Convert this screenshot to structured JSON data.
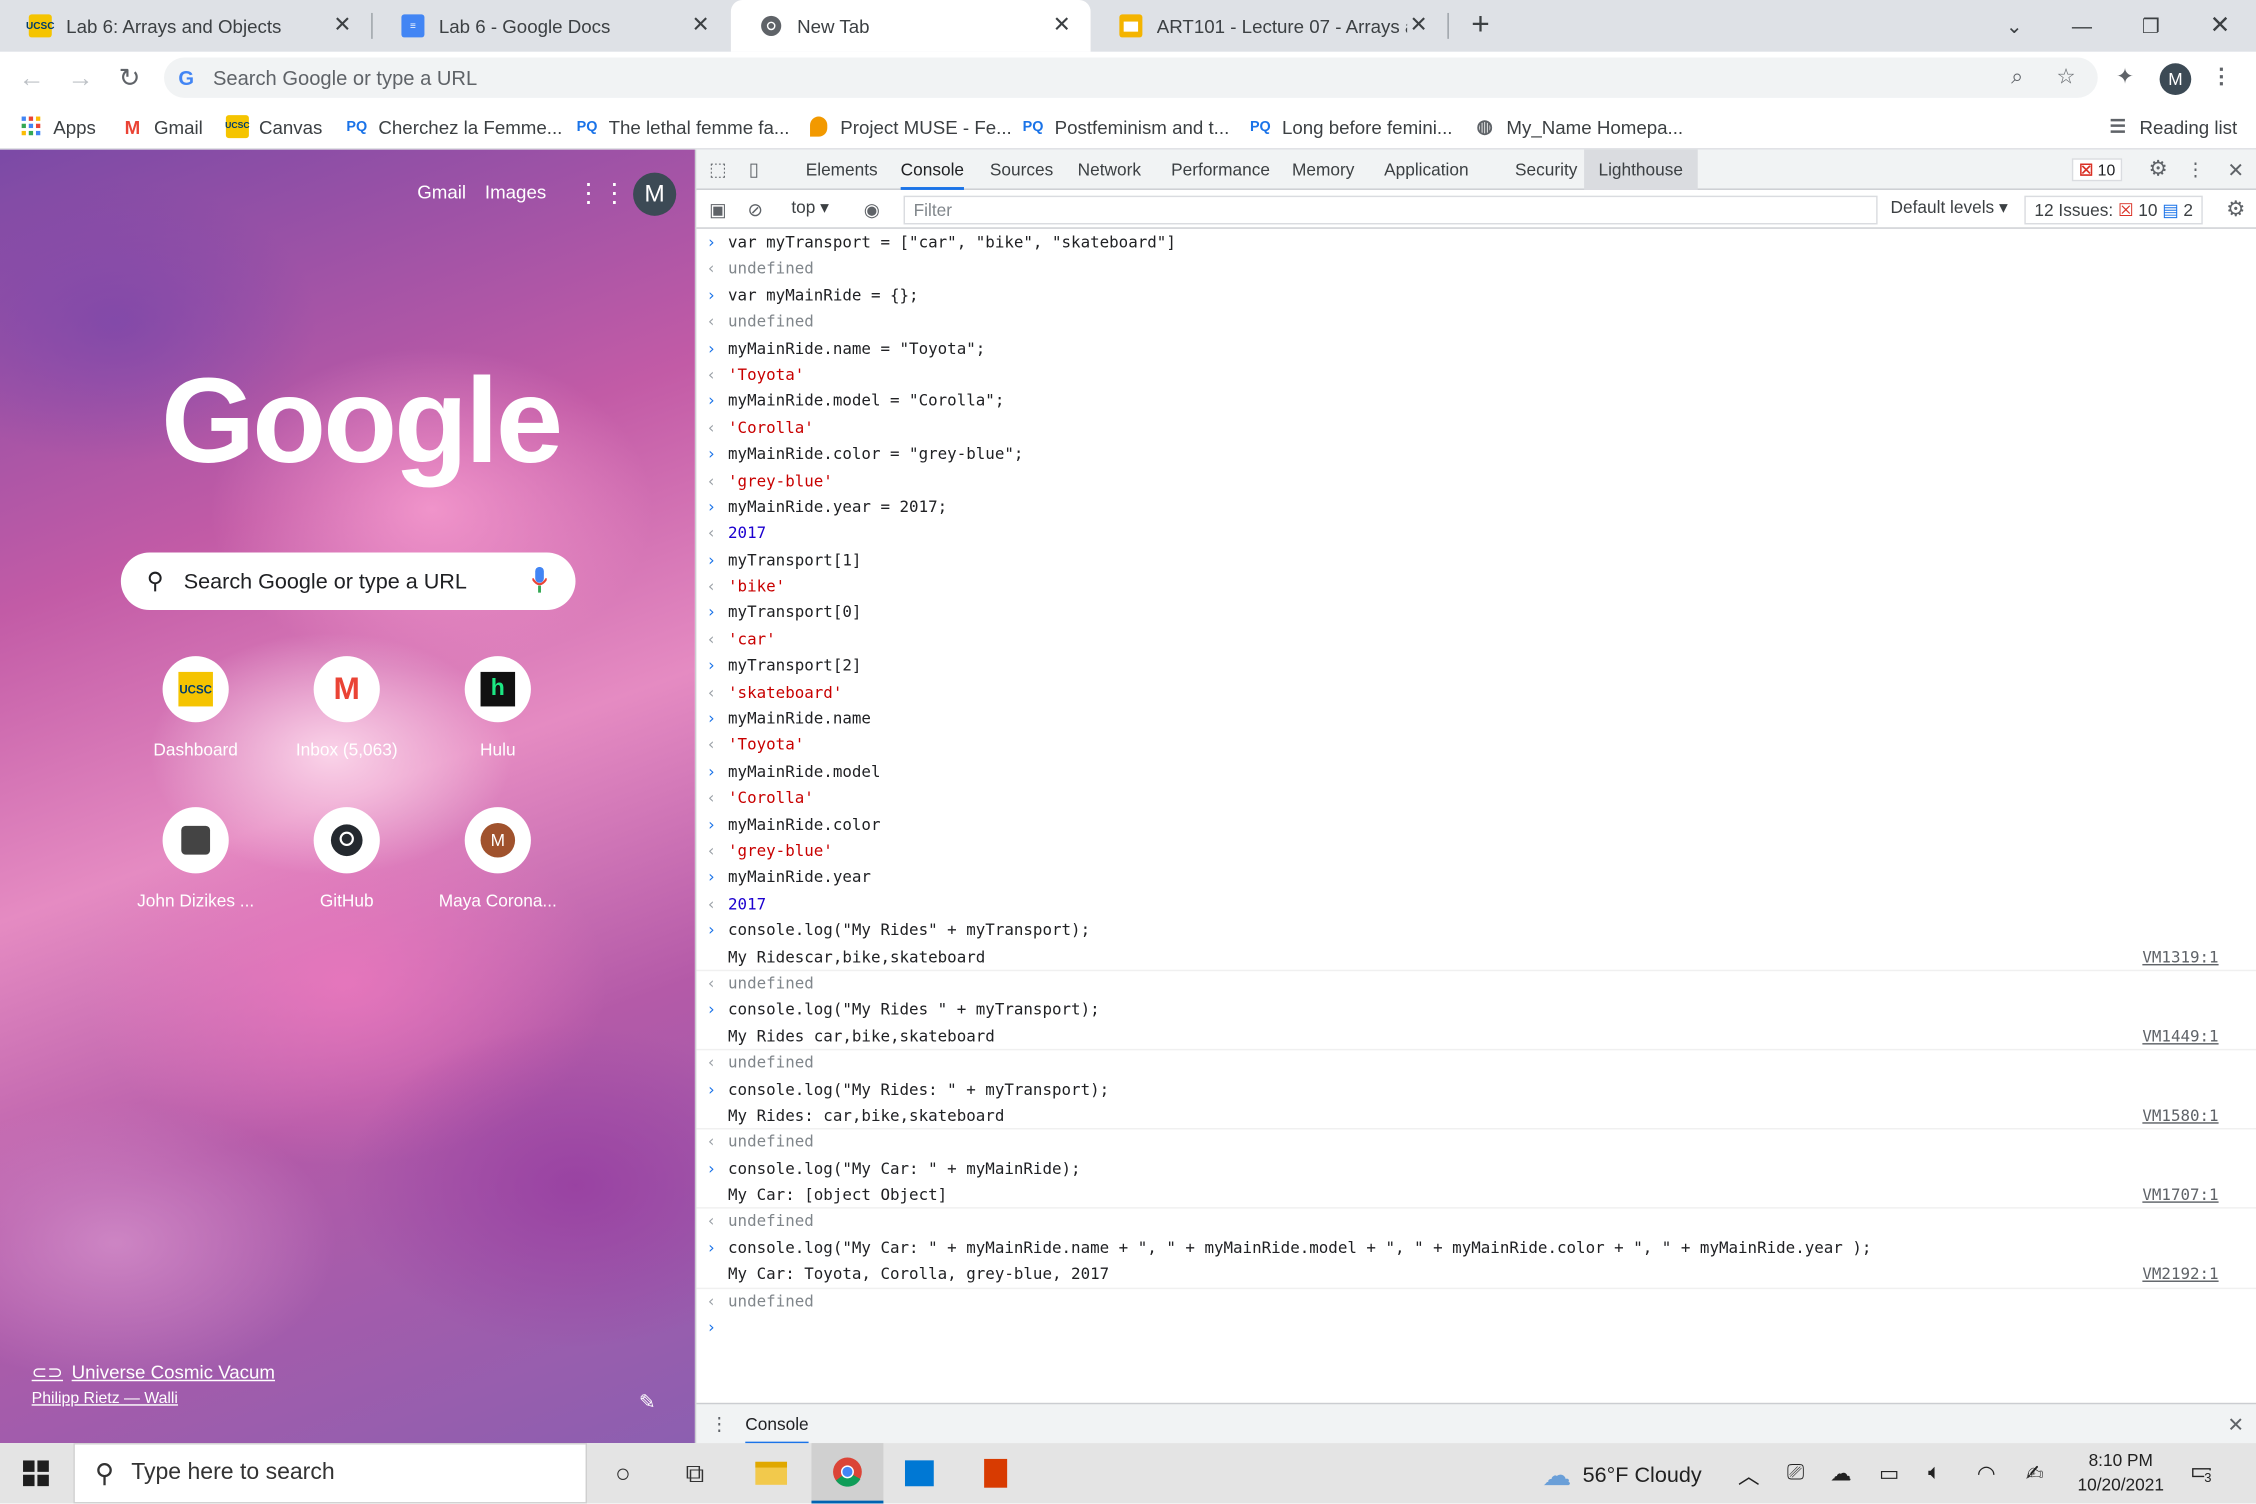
{
  "tabs": [
    {
      "title": "Lab 6: Arrays and Objects",
      "favicon": "ucsc-icon",
      "active": false
    },
    {
      "title": "Lab 6 - Google Docs",
      "favicon": "docs-icon",
      "active": false
    },
    {
      "title": "New Tab",
      "favicon": "chrome-icon",
      "active": true
    },
    {
      "title": "ART101 - Lecture 07 - Arrays and",
      "favicon": "slides-icon",
      "active": false
    }
  ],
  "omnibox": {
    "placeholder": "Search Google or type a URL"
  },
  "bookmarks": {
    "apps": "Apps",
    "items": [
      "Gmail",
      "Canvas",
      "Cherchez la Femme...",
      "The lethal femme fa...",
      "Project MUSE - Fe...",
      "Postfeminism and t...",
      "Long before femini...",
      "My_Name Homepa..."
    ],
    "reading_list": "Reading list"
  },
  "ntp": {
    "gmail": "Gmail",
    "images": "Images",
    "avatar": "M",
    "logo": "Google",
    "search_placeholder": "Search Google or type a URL",
    "shortcuts": [
      "Dashboard",
      "Inbox (5,063)",
      "Hulu",
      "John Dizikes ...",
      "GitHub",
      "Maya Corona..."
    ],
    "attribution_title": "Universe Cosmic Vacum",
    "attribution_author": "Philipp Rietz — Walli"
  },
  "devtools": {
    "tabs": [
      "Elements",
      "Console",
      "Sources",
      "Network",
      "Performance",
      "Memory",
      "Application",
      "Security",
      "Lighthouse"
    ],
    "active_tab": "Console",
    "error_count": "10",
    "context": "top",
    "filter_placeholder": "Filter",
    "levels": "Default levels",
    "issues_label": "12 Issues:",
    "issues_errors": "10",
    "issues_info": "2",
    "drawer_tab": "Console"
  },
  "console": {
    "l1": "var myTransport = [\"car\", \"bike\", \"skateboard\"]",
    "undef": "undefined",
    "l2": "var myMainRide = {};",
    "l3": "myMainRide.name = \"Toyota\";",
    "r3": "'Toyota'",
    "l4": "myMainRide.model = \"Corolla\";",
    "r4": "'Corolla'",
    "l5": "myMainRide.color = \"grey-blue\";",
    "r5": "'grey-blue'",
    "l6": "myMainRide.year = 2017;",
    "r6": "2017",
    "l7": "myTransport[1]",
    "r7": "'bike'",
    "l8": "myTransport[0]",
    "r8": "'car'",
    "l9": "myTransport[2]",
    "r9": "'skateboard'",
    "l10": "myMainRide.name",
    "l11": "myMainRide.model",
    "l12": "myMainRide.color",
    "l13": "myMainRide.year",
    "l14": "console.log(\"My Rides\" + myTransport);",
    "o14": "My Ridescar,bike,skateboard",
    "s14": "VM1319:1",
    "l15": "console.log(\"My Rides \" + myTransport);",
    "o15": "My Rides car,bike,skateboard",
    "s15": "VM1449:1",
    "l16": "console.log(\"My Rides: \" + myTransport);",
    "o16": "My Rides: car,bike,skateboard",
    "s16": "VM1580:1",
    "l17": "console.log(\"My Car: \" + myMainRide);",
    "o17": "My Car: [object Object]",
    "s17": "VM1707:1",
    "l18": "console.log(\"My Car: \" + myMainRide.name + \", \" + myMainRide.model + \", \" + myMainRide.color + \", \" + myMainRide.year );",
    "o18": "My Car: Toyota, Corolla, grey-blue, 2017",
    "s18": "VM2192:1"
  },
  "taskbar": {
    "search_placeholder": "Type here to search",
    "weather": "56°F  Cloudy",
    "time": "8:10 PM",
    "date": "10/20/2021",
    "notifications": "3"
  }
}
